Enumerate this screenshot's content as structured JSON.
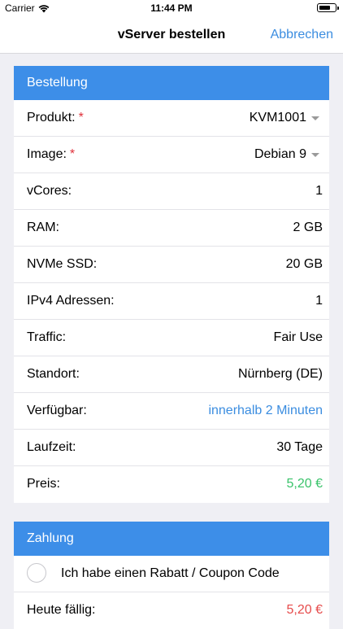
{
  "status_bar": {
    "carrier": "Carrier",
    "time": "11:44 PM",
    "battery_level": 0.7
  },
  "nav": {
    "title": "vServer bestellen",
    "cancel_label": "Abbrechen"
  },
  "order": {
    "header": "Bestellung",
    "rows": [
      {
        "label": "Produkt:",
        "required_mark": "*",
        "value": "KVM1001"
      },
      {
        "label": "Image:",
        "required_mark": "*",
        "value": "Debian 9"
      },
      {
        "label": "vCores:",
        "value": "1"
      },
      {
        "label": "RAM:",
        "value": "2 GB"
      },
      {
        "label": "NVMe SSD:",
        "value": "20 GB"
      },
      {
        "label": "IPv4 Adressen:",
        "value": "1"
      },
      {
        "label": "Traffic:",
        "value": "Fair Use"
      },
      {
        "label": "Standort:",
        "value": "Nürnberg (DE)"
      },
      {
        "label": "Verfügbar:",
        "value": "innerhalb 2 Minuten"
      },
      {
        "label": "Laufzeit:",
        "value": "30 Tage"
      },
      {
        "label": "Preis:",
        "value": "5,20 €"
      }
    ]
  },
  "payment": {
    "header": "Zahlung",
    "coupon_label": "Ich habe einen Rabatt / Coupon Code",
    "due_label": "Heute fällig:",
    "due_value": "5,20 €"
  },
  "colors": {
    "accent": "#3d8ee8",
    "link": "#3b8de0",
    "price": "#39c36a",
    "required": "#e0303a",
    "due": "#e64b4b"
  }
}
